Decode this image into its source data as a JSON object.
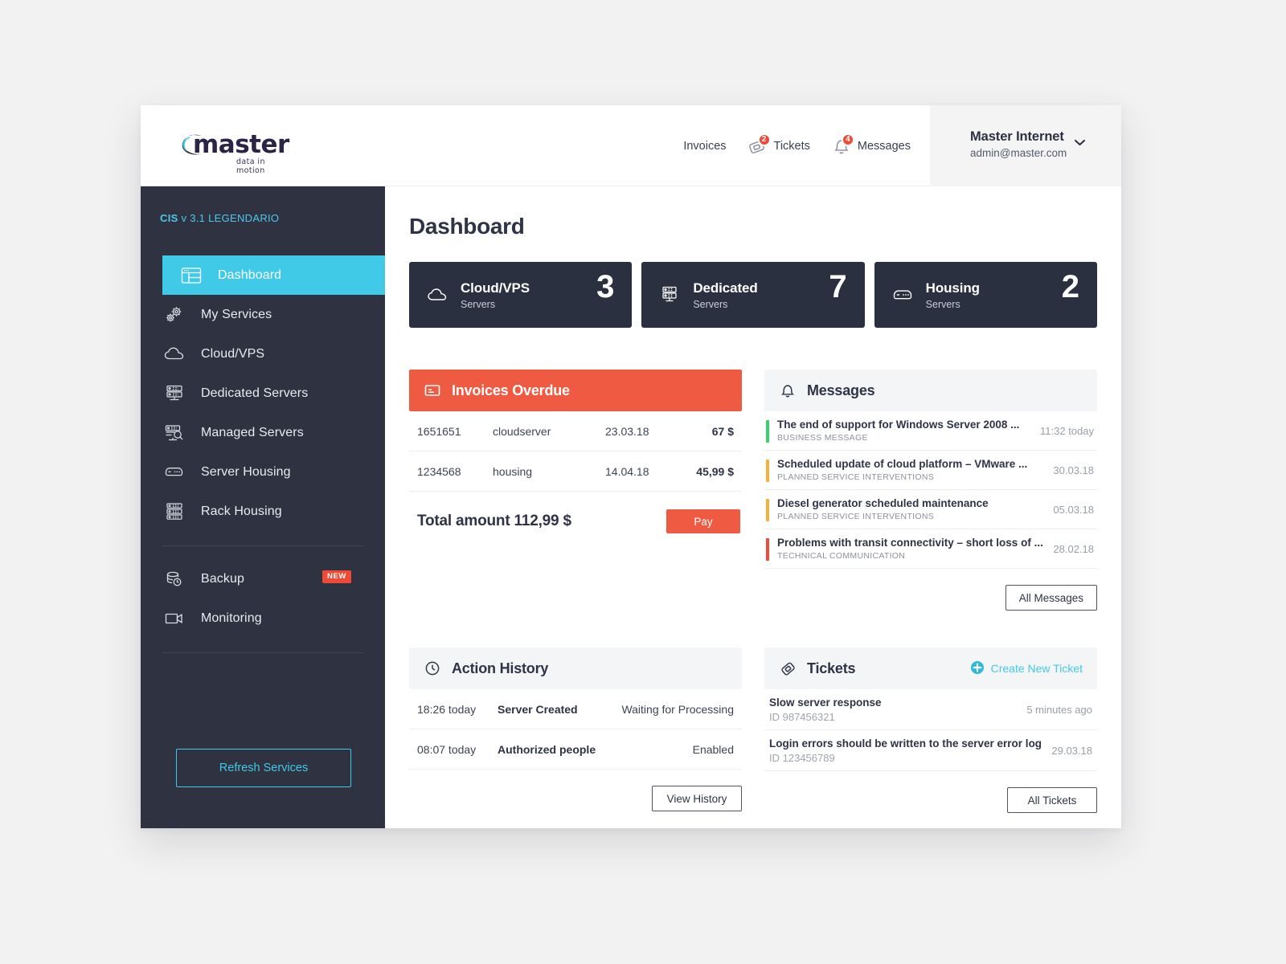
{
  "brand": {
    "logo_word": "master",
    "logo_tagline": "data in motion",
    "accent_cyan": "#41c9e8",
    "accent_red": "#ef5a43",
    "sidebar_bg": "#2e3241",
    "card_bg": "#2b3041"
  },
  "topnav": {
    "items": [
      {
        "label": "Invoices",
        "icon": "",
        "badge": null
      },
      {
        "label": "Tickets",
        "icon": "ticket-icon",
        "badge": "2"
      },
      {
        "label": "Messages",
        "icon": "bell-icon",
        "badge": "4"
      }
    ]
  },
  "user": {
    "name": "Master Internet",
    "email": "admin@master.com",
    "caret_icon": "chevron-down-icon"
  },
  "sidebar": {
    "version_prefix": "CIS",
    "version_text": " v 3.1 LEGENDARIO",
    "items": [
      {
        "label": "Dashboard",
        "icon": "dashboard-icon",
        "active": true
      },
      {
        "label": "My Services",
        "icon": "gears-icon",
        "active": false
      },
      {
        "label": "Cloud/VPS",
        "icon": "cloud-icon",
        "active": false
      },
      {
        "label": "Dedicated Servers",
        "icon": "server-rack-icon",
        "active": false
      },
      {
        "label": "Managed Servers",
        "icon": "server-search-icon",
        "active": false
      },
      {
        "label": "Server Housing",
        "icon": "server-unit-icon",
        "active": false
      },
      {
        "label": "Rack Housing",
        "icon": "rack-icon",
        "active": false
      }
    ],
    "secondary_items": [
      {
        "label": "Backup",
        "icon": "backup-icon",
        "badge": "NEW"
      },
      {
        "label": "Monitoring",
        "icon": "monitor-camera-icon",
        "badge": null
      }
    ],
    "refresh_label": "Refresh Services"
  },
  "main": {
    "page_title": "Dashboard",
    "stats": [
      {
        "title": "Cloud/VPS",
        "subtitle": "Servers",
        "count": "3",
        "icon": "cloud-icon"
      },
      {
        "title": "Dedicated",
        "subtitle": "Servers",
        "count": "7",
        "icon": "server-rack-icon"
      },
      {
        "title": "Housing",
        "subtitle": "Servers",
        "count": "2",
        "icon": "server-unit-icon"
      }
    ]
  },
  "invoices": {
    "title": "Invoices Overdue",
    "icon": "invoice-card-icon",
    "rows": [
      {
        "id": "1651651",
        "service": "cloudserver",
        "date": "23.03.18",
        "amount": "67 $"
      },
      {
        "id": "1234568",
        "service": "housing",
        "date": "14.04.18",
        "amount": "45,99 $"
      }
    ],
    "total_label": "Total amount 112,99 $",
    "pay_label": "Pay"
  },
  "messages": {
    "title": "Messages",
    "icon": "bell-icon",
    "rows": [
      {
        "title": "The end of support for Windows Server 2008 ...",
        "category": "BUSINESS MESSAGE",
        "time": "11:32 today",
        "color": "#3dcf6e"
      },
      {
        "title": "Scheduled update of cloud platform – VMware ...",
        "category": "PLANNED SERVICE INTERVENTIONS",
        "time": "30.03.18",
        "color": "#f9b03a"
      },
      {
        "title": "Diesel generator scheduled maintenance",
        "category": "PLANNED SERVICE INTERVENTIONS",
        "time": "05.03.18",
        "color": "#f9b03a"
      },
      {
        "title": "Problems with transit connectivity – short loss of ...",
        "category": "TECHNICAL COMMUNICATION",
        "time": "28.02.18",
        "color": "#ef4a3a"
      }
    ],
    "footer_button": "All Messages"
  },
  "action_history": {
    "title": "Action History",
    "icon": "clock-icon",
    "rows": [
      {
        "time": "18:26 today",
        "action": "Server Created",
        "status": "Waiting for Processing"
      },
      {
        "time": "08:07 today",
        "action": "Authorized people",
        "status": "Enabled"
      }
    ],
    "footer_button": "View History"
  },
  "tickets": {
    "title": "Tickets",
    "icon": "ticket-icon",
    "create_label": "Create New Ticket",
    "create_icon": "plus-circle-icon",
    "rows": [
      {
        "title": "Slow server response",
        "id": "ID 987456321",
        "time": "5 minutes ago"
      },
      {
        "title": "Login errors should be written to the server error log",
        "id": "ID 123456789",
        "time": "29.03.18"
      }
    ],
    "footer_button": "All Tickets"
  }
}
